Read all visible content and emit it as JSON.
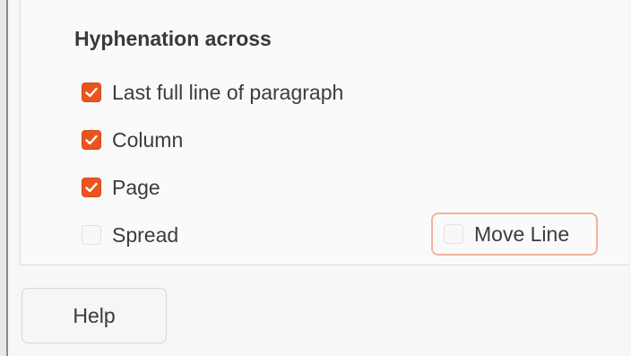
{
  "section": {
    "title": "Hyphenation across"
  },
  "options": [
    {
      "label": "Last full line of paragraph",
      "checked": true
    },
    {
      "label": "Column",
      "checked": true
    },
    {
      "label": "Page",
      "checked": true
    },
    {
      "label": "Spread",
      "checked": false
    }
  ],
  "move_line": {
    "label": "Move Line",
    "checked": false
  },
  "buttons": {
    "help_label": "Help"
  },
  "colors": {
    "accent": "#e95420",
    "focus_ring": "#f0b49f"
  }
}
